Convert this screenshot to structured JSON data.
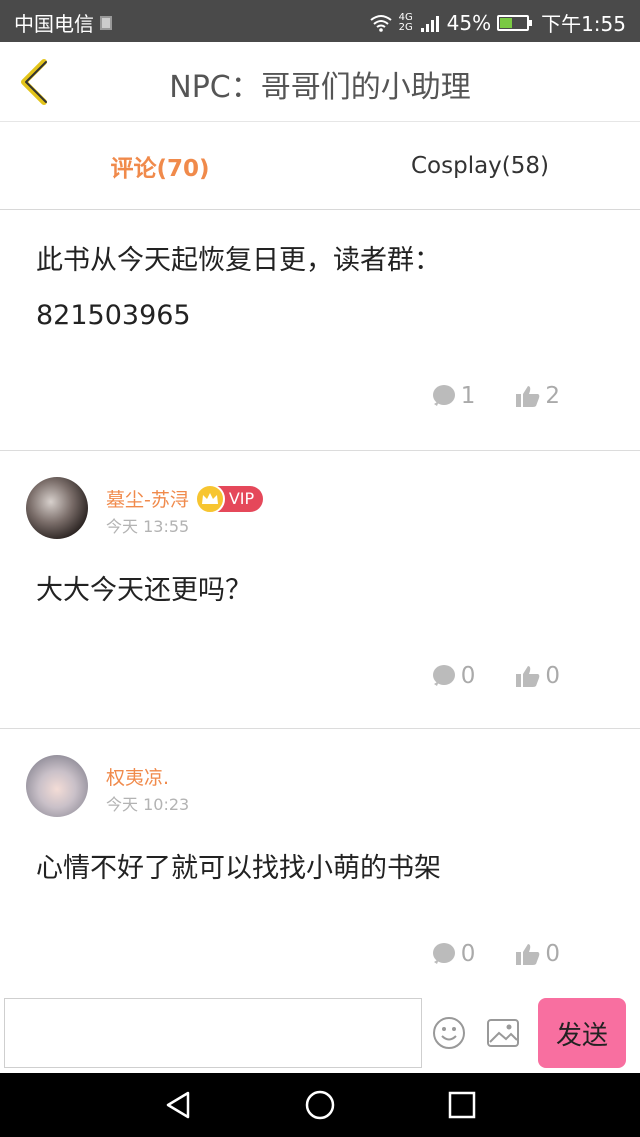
{
  "status_bar": {
    "carrier": "中国电信",
    "network": "4G 2G",
    "battery": "45%",
    "battery_level": 0.45,
    "time": "下午1:55"
  },
  "header": {
    "title": "NPC：哥哥们的小助理",
    "back_icon": "chevron-left-icon"
  },
  "tabs": [
    {
      "label": "评论(70)",
      "active": true
    },
    {
      "label": "Cosplay(58)",
      "active": false
    }
  ],
  "first_post": {
    "text_line1": "此书从今天起恢复日更，读者群：",
    "text_line2": "821503965",
    "comments": "1",
    "likes": "2"
  },
  "comments": [
    {
      "username": "墓尘-苏浔",
      "vip": true,
      "vip_label": "VIP",
      "time": "今天 13:55",
      "text": "大大今天还更吗？",
      "replies": "0",
      "likes": "0"
    },
    {
      "username": "权夷凉.",
      "vip": false,
      "time": "今天 10:23",
      "text": "心情不好了就可以找找小萌的书架",
      "replies": "0",
      "likes": "0"
    }
  ],
  "input": {
    "placeholder": "",
    "send_label": "发送"
  },
  "colors": {
    "accent": "#f08a4b",
    "send": "#f86fa0",
    "vip": "#e5485a"
  }
}
